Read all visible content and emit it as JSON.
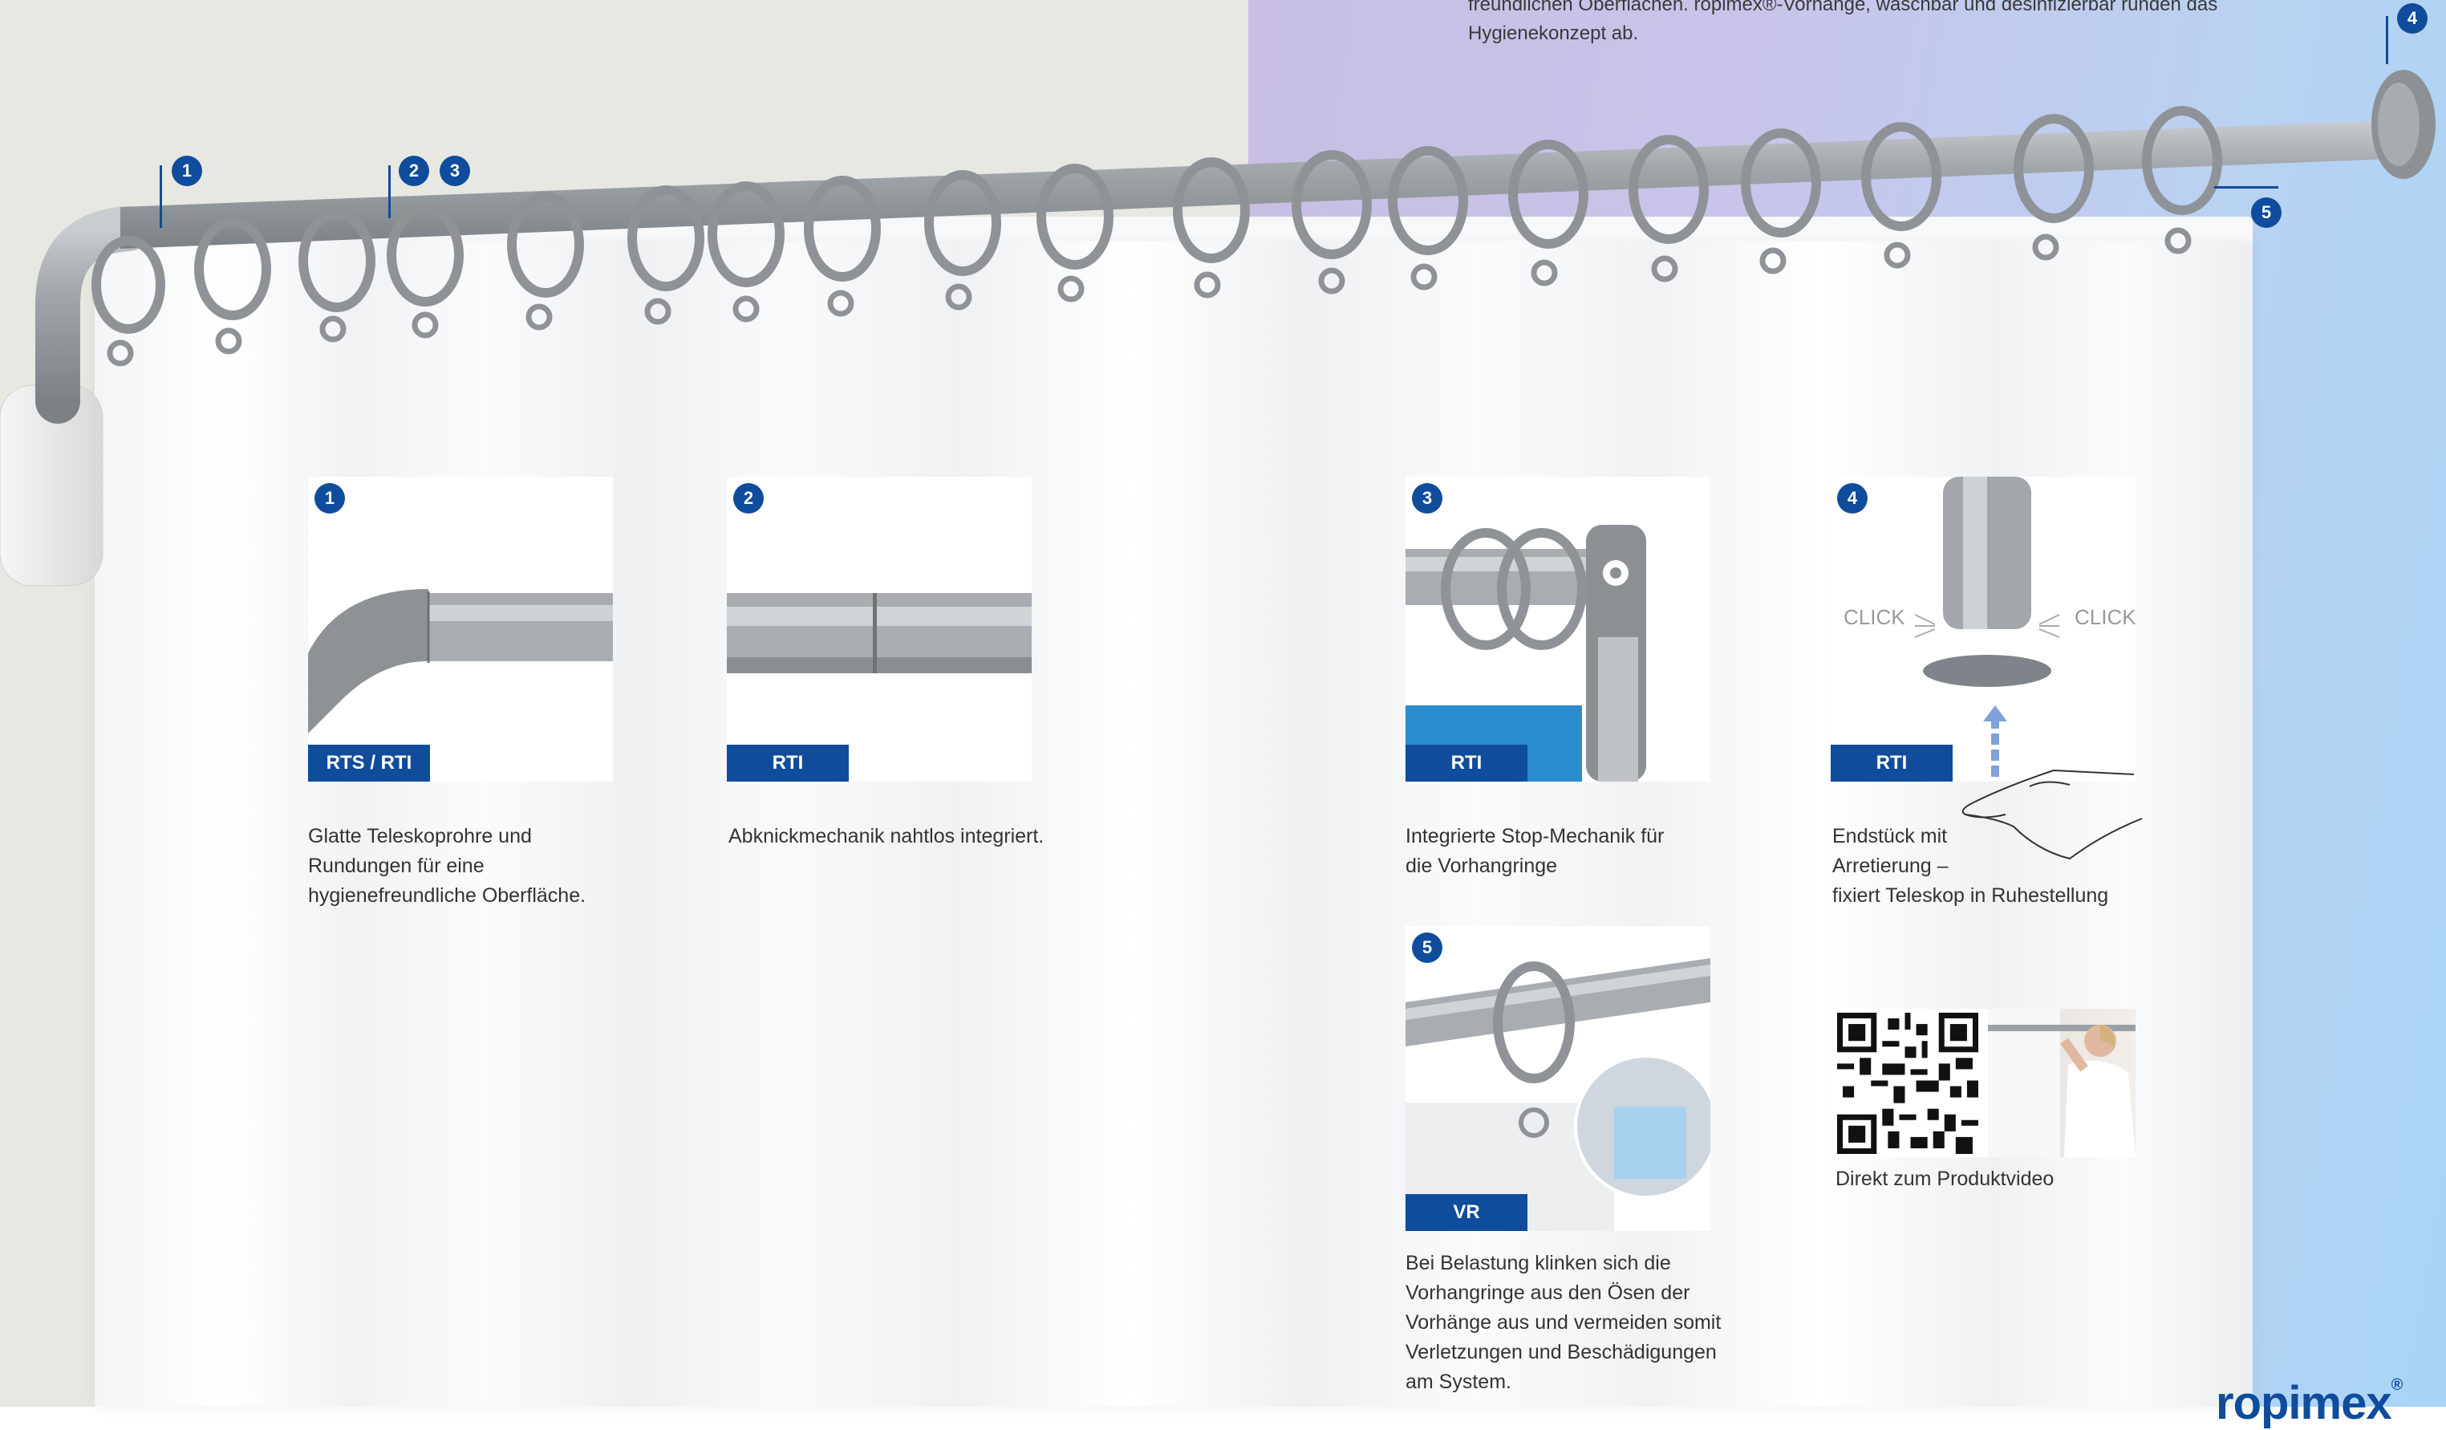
{
  "intro": {
    "line1": "freundlichen Oberflächen. ropimex®-Vorhänge, waschbar und desinfizierbar runden das",
    "line2": "Hygienekonzept ab."
  },
  "markers": {
    "m1": "1",
    "m2": "2",
    "m3": "3",
    "m4": "4",
    "m5": "5"
  },
  "cards": [
    {
      "num": "1",
      "tag": "RTS / RTI",
      "text": [
        "Glatte Teleskoprohre und",
        "Rundungen für eine",
        "hygienefreundliche Oberfläche."
      ]
    },
    {
      "num": "2",
      "tag": "RTI",
      "text": [
        "Abknickmechanik nahtlos integriert."
      ]
    },
    {
      "num": "3",
      "tag": "RTI",
      "text": [
        "Integrierte Stop-Mechanik für",
        "die Vorhangringe"
      ]
    },
    {
      "num": "4",
      "tag": "RTI",
      "click_left": "CLICK",
      "click_right": "CLICK",
      "text": [
        "Endstück mit",
        "Arretierung –",
        "fixiert Teleskop in Ruhestellung"
      ]
    },
    {
      "num": "5",
      "tag": "VR",
      "text": [
        "Bei Belastung klinken sich die",
        "Vorhangringe aus den Ösen der",
        "Vorhänge aus und vermeiden somit",
        "Verletzungen und Beschädigungen",
        "am System."
      ]
    }
  ],
  "video": {
    "caption": "Direkt zum Produktvideo"
  },
  "logo": {
    "name": "ropimex",
    "mark": "®"
  },
  "colors": {
    "brand_blue": "#0f4c9c",
    "rod_gray": "#9ea3a8",
    "ring_gray": "#8f9398"
  }
}
